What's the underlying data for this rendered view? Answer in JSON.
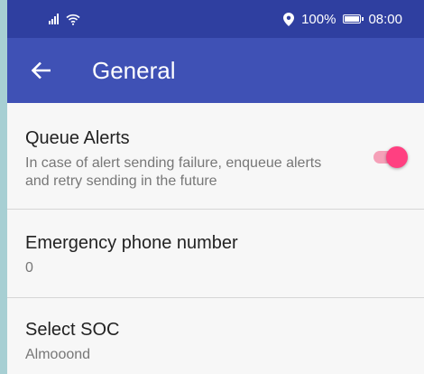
{
  "status_bar": {
    "battery_percent": "100%",
    "time": "08:00",
    "icons": [
      "signal-icon",
      "wifi-icon",
      "location-icon",
      "battery-icon"
    ]
  },
  "app_bar": {
    "title": "General",
    "back_icon": "arrow-left-icon"
  },
  "settings": {
    "queue_alerts": {
      "title": "Queue Alerts",
      "summary": "In case of alert sending failure, enqueue alerts and retry sending in the future",
      "enabled": true
    },
    "emergency_phone": {
      "title": "Emergency phone number",
      "value": "0"
    },
    "select_soc": {
      "title": "Select SOC",
      "value": "Almooond"
    }
  },
  "colors": {
    "status_bar": "#2f3fa0",
    "app_bar": "#3f51b5",
    "toggle_thumb": "#ff4081",
    "toggle_track": "#f5a0b8"
  }
}
